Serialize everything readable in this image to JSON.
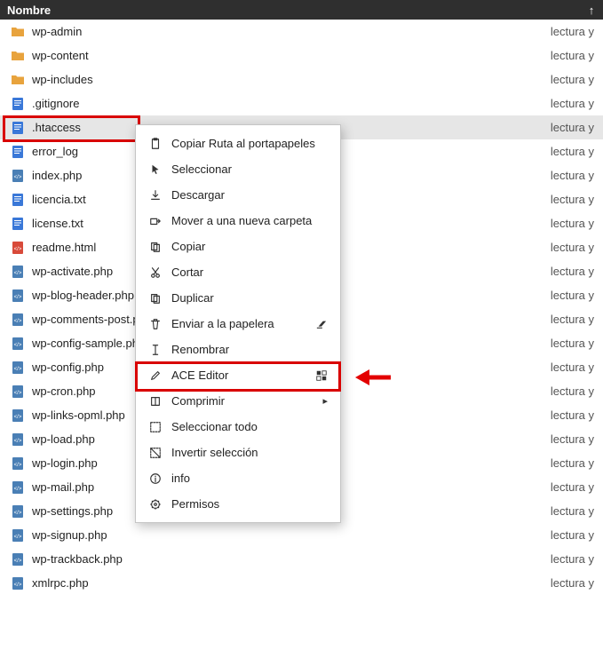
{
  "header": {
    "name_label": "Nombre",
    "sort_glyph": "↑"
  },
  "perm_text": "lectura y",
  "files": [
    {
      "type": "folder",
      "name": "wp-admin"
    },
    {
      "type": "folder",
      "name": "wp-content"
    },
    {
      "type": "folder",
      "name": "wp-includes"
    },
    {
      "type": "txt",
      "name": ".gitignore"
    },
    {
      "type": "txt",
      "name": ".htaccess",
      "selected": true
    },
    {
      "type": "txt",
      "name": "error_log"
    },
    {
      "type": "php",
      "name": "index.php"
    },
    {
      "type": "txt",
      "name": "licencia.txt"
    },
    {
      "type": "txt",
      "name": "license.txt"
    },
    {
      "type": "html",
      "name": "readme.html"
    },
    {
      "type": "php",
      "name": "wp-activate.php"
    },
    {
      "type": "php",
      "name": "wp-blog-header.php"
    },
    {
      "type": "php",
      "name": "wp-comments-post.php"
    },
    {
      "type": "php",
      "name": "wp-config-sample.php"
    },
    {
      "type": "php",
      "name": "wp-config.php"
    },
    {
      "type": "php",
      "name": "wp-cron.php"
    },
    {
      "type": "php",
      "name": "wp-links-opml.php"
    },
    {
      "type": "php",
      "name": "wp-load.php"
    },
    {
      "type": "php",
      "name": "wp-login.php"
    },
    {
      "type": "php",
      "name": "wp-mail.php"
    },
    {
      "type": "php",
      "name": "wp-settings.php"
    },
    {
      "type": "php",
      "name": "wp-signup.php"
    },
    {
      "type": "php",
      "name": "wp-trackback.php"
    },
    {
      "type": "php",
      "name": "xmlrpc.php"
    }
  ],
  "menu": [
    {
      "icon": "clipboard-icon",
      "label": "Copiar Ruta al portapapeles"
    },
    {
      "icon": "cursor-icon",
      "label": "Seleccionar"
    },
    {
      "icon": "download-icon",
      "label": "Descargar"
    },
    {
      "icon": "move-icon",
      "label": "Mover a una nueva carpeta"
    },
    {
      "icon": "copy-icon",
      "label": "Copiar"
    },
    {
      "icon": "cut-icon",
      "label": "Cortar"
    },
    {
      "icon": "duplicate-icon",
      "label": "Duplicar"
    },
    {
      "icon": "trash-icon",
      "label": "Enviar a la papelera",
      "raux": "eraser"
    },
    {
      "icon": "rename-icon",
      "label": "Renombrar"
    },
    {
      "icon": "edit-icon",
      "label": "ACE Editor",
      "highlight": true,
      "raux": "ace"
    },
    {
      "icon": "compress-icon",
      "label": "Comprimir",
      "submenu": true
    },
    {
      "icon": "selectall-icon",
      "label": "Seleccionar todo"
    },
    {
      "icon": "invert-icon",
      "label": "Invertir selección"
    },
    {
      "icon": "info-icon",
      "label": "info"
    },
    {
      "icon": "permissions-icon",
      "label": "Permisos"
    }
  ],
  "icon_colors": {
    "folder": "#e8a33d",
    "txt": "#3a78d8",
    "php": "#4a7fb5",
    "html": "#d84a3a"
  }
}
